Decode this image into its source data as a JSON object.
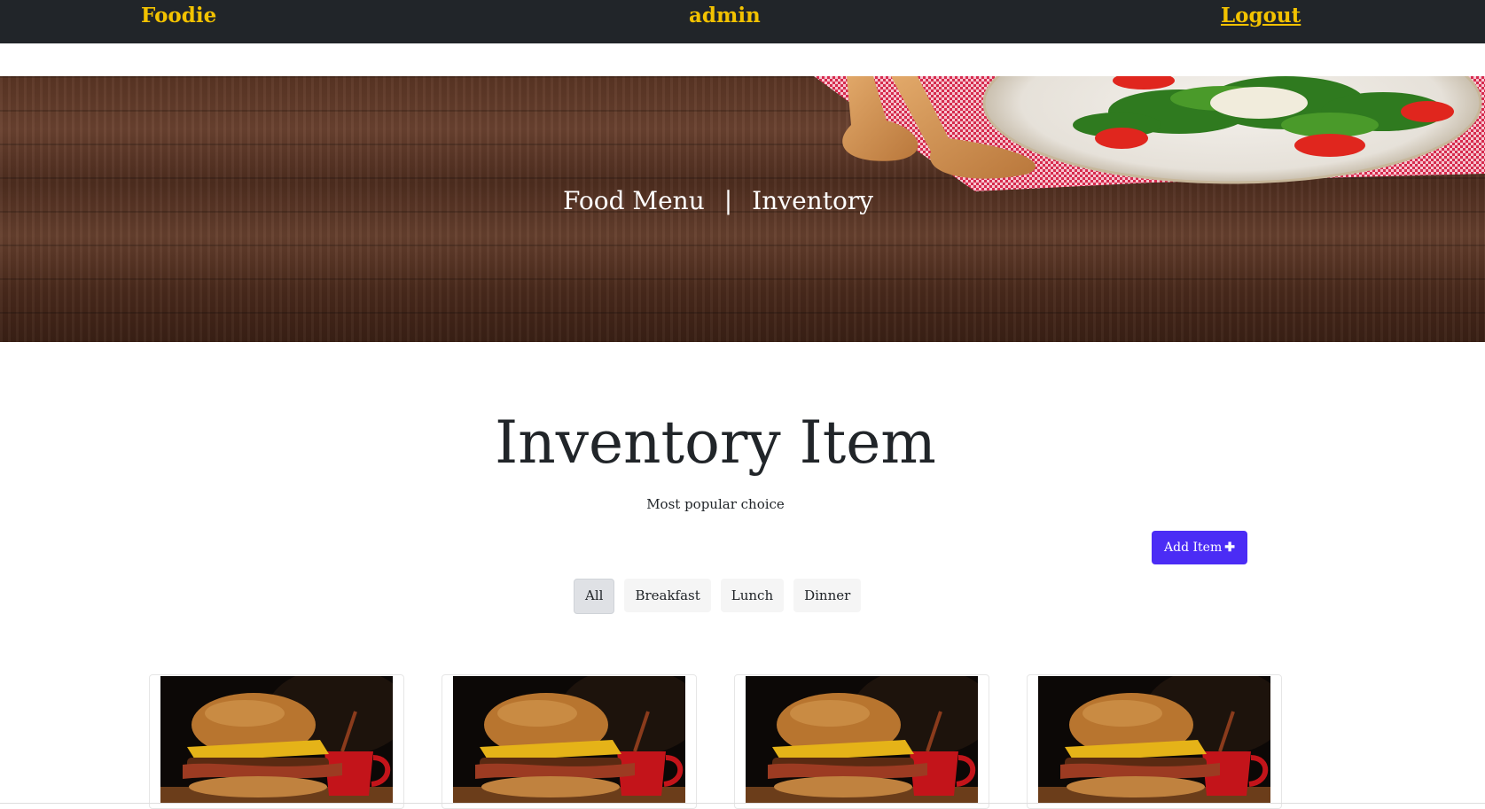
{
  "navbar": {
    "brand": "Foodie",
    "user": "admin",
    "logout": "Logout"
  },
  "hero": {
    "link_menu": "Food Menu",
    "separator": "|",
    "link_inventory": "Inventory"
  },
  "main": {
    "title": "Inventory Item",
    "subtitle": "Most popular choice",
    "add_button_label": "Add Item",
    "add_button_icon": "plus-icon"
  },
  "filters": [
    {
      "label": "All",
      "active": true
    },
    {
      "label": "Breakfast",
      "active": false
    },
    {
      "label": "Lunch",
      "active": false
    },
    {
      "label": "Dinner",
      "active": false
    }
  ],
  "cards": [
    {
      "image": "burger-image"
    },
    {
      "image": "burger-image"
    },
    {
      "image": "burger-image"
    },
    {
      "image": "burger-image"
    }
  ],
  "colors": {
    "navbar_bg": "#212529",
    "nav_text": "#f2c200",
    "accent_button": "#4b2cf5"
  }
}
